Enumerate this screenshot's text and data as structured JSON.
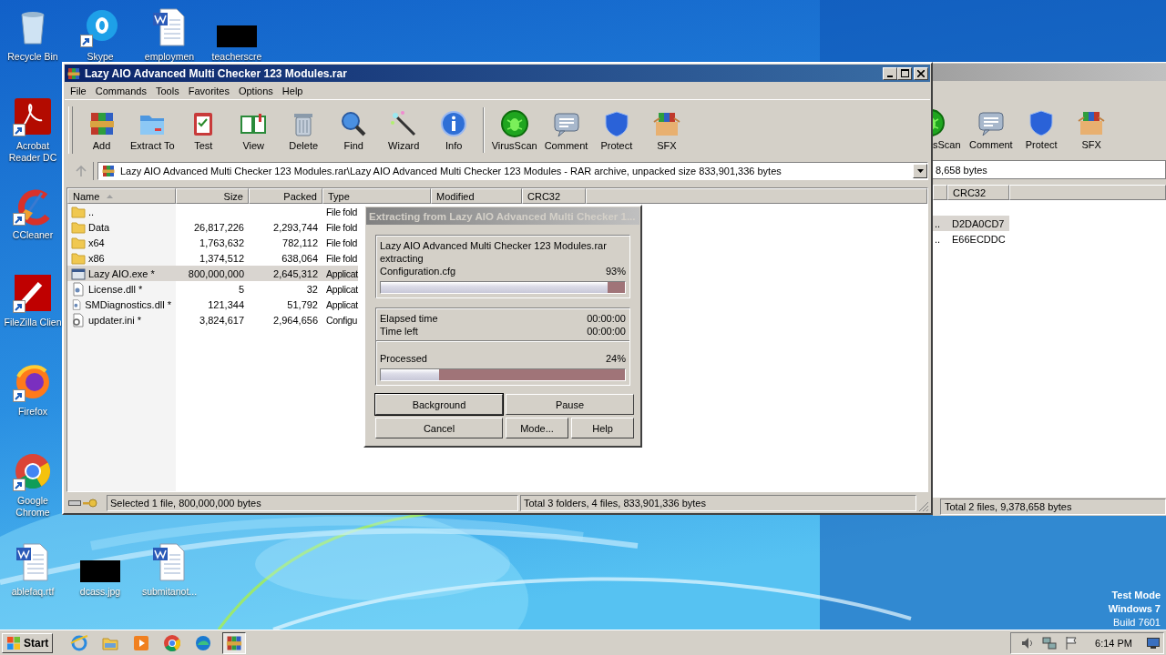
{
  "desktop_icons": [
    {
      "label": "Recycle Bin",
      "kind": "recycle",
      "shortcut": false
    },
    {
      "label": "Skype",
      "kind": "skype",
      "shortcut": true
    },
    {
      "label": "employmen",
      "kind": "word",
      "shortcut": false
    },
    {
      "label": "teacherscre",
      "kind": "redacted",
      "shortcut": false
    },
    {
      "label": "Acrobat Reader DC",
      "kind": "acrobat",
      "shortcut": true
    },
    {
      "label": "CCleaner",
      "kind": "ccleaner",
      "shortcut": true
    },
    {
      "label": "FileZilla Clien",
      "kind": "filezilla",
      "shortcut": true
    },
    {
      "label": "Firefox",
      "kind": "firefox",
      "shortcut": true
    },
    {
      "label": "Google Chrome",
      "kind": "chrome",
      "shortcut": true
    },
    {
      "label": "ablefaq.rtf",
      "kind": "word",
      "shortcut": false
    },
    {
      "label": "dcass.jpg",
      "kind": "redacted",
      "shortcut": false
    },
    {
      "label": "submitanot...",
      "kind": "word",
      "shortcut": false
    }
  ],
  "system_notice": [
    {
      "text": "Test Mode",
      "strong": true
    },
    {
      "text": "Windows 7",
      "strong": true
    },
    {
      "text": "Build 7601",
      "strong": false
    }
  ],
  "back_window": {
    "toolbar": [
      {
        "label": "sScan",
        "kind": "virus"
      },
      {
        "label": "Comment",
        "kind": "comment"
      },
      {
        "label": "Protect",
        "kind": "protect"
      },
      {
        "label": "SFX",
        "kind": "sfx"
      }
    ],
    "address": "8,658 bytes",
    "columns": [
      "CRC32"
    ],
    "rows": [
      {
        "column_1": "..",
        "crc32": "D2DA0CD7",
        "selected": true
      },
      {
        "column_1": "..",
        "crc32": "E66ECDDC",
        "selected": false
      }
    ],
    "status": "Total 2 files, 9,378,658 bytes"
  },
  "main_window": {
    "title": "Lazy AIO Advanced Multi Checker 123 Modules.rar",
    "menu": [
      "File",
      "Commands",
      "Tools",
      "Favorites",
      "Options",
      "Help"
    ],
    "toolbar_groups": [
      [
        {
          "label": "Add",
          "kind": "add"
        },
        {
          "label": "Extract To",
          "kind": "extract"
        },
        {
          "label": "Test",
          "kind": "test"
        },
        {
          "label": "View",
          "kind": "view"
        },
        {
          "label": "Delete",
          "kind": "delete"
        },
        {
          "label": "Find",
          "kind": "find"
        },
        {
          "label": "Wizard",
          "kind": "wizard"
        },
        {
          "label": "Info",
          "kind": "info"
        }
      ],
      [
        {
          "label": "VirusScan",
          "kind": "virus"
        },
        {
          "label": "Comment",
          "kind": "comment"
        },
        {
          "label": "Protect",
          "kind": "protect"
        },
        {
          "label": "SFX",
          "kind": "sfx"
        }
      ]
    ],
    "address": "Lazy AIO Advanced Multi Checker 123 Modules.rar\\Lazy AIO Advanced Multi Checker 123 Modules - RAR archive, unpacked size 833,901,336 bytes",
    "columns": [
      "Name",
      "Size",
      "Packed",
      "Type",
      "Modified",
      "CRC32"
    ],
    "rows": [
      {
        "name": "..",
        "type": "File fold",
        "kind": "parent",
        "selected": false
      },
      {
        "name": "Data",
        "size": "26,817,226",
        "packed": "2,293,744",
        "type": "File fold",
        "kind": "folder",
        "selected": false
      },
      {
        "name": "x64",
        "size": "1,763,632",
        "packed": "782,112",
        "type": "File fold",
        "kind": "folder",
        "selected": false
      },
      {
        "name": "x86",
        "size": "1,374,512",
        "packed": "638,064",
        "type": "File fold",
        "kind": "folder",
        "selected": false
      },
      {
        "name": "Lazy AIO.exe *",
        "size": "800,000,000",
        "packed": "2,645,312",
        "type": "Applicat",
        "kind": "exe",
        "selected": true
      },
      {
        "name": "License.dll *",
        "size": "5",
        "packed": "32",
        "type": "Applicat",
        "kind": "dll",
        "selected": false
      },
      {
        "name": "SMDiagnostics.dll *",
        "size": "121,344",
        "packed": "51,792",
        "type": "Applicat",
        "kind": "dll",
        "selected": false
      },
      {
        "name": "updater.ini *",
        "size": "3,824,617",
        "packed": "2,964,656",
        "type": "Configu",
        "kind": "ini",
        "selected": false
      }
    ],
    "status": [
      "Selected 1 file, 800,000,000 bytes",
      "Total 3 folders, 4 files, 833,901,336 bytes"
    ]
  },
  "dialog": {
    "title": "Extracting from Lazy AIO Advanced Multi Checker 1...",
    "archive": "Lazy AIO Advanced Multi Checker 123 Modules.rar",
    "action": "extracting",
    "file": "Configuration.cfg",
    "file_percent": "93%",
    "file_bar": {
      "level": 0.93
    },
    "elapsed_label": "Elapsed time",
    "elapsed": "00:00:00",
    "left_label": "Time left",
    "left": "00:00:00",
    "processed_label": "Processed",
    "processed_percent": "24%",
    "processed_bar": {
      "level": 0.24
    },
    "buttons": [
      {
        "label": "Background",
        "focused": true
      },
      {
        "label": "Pause",
        "focused": false
      },
      {
        "label": "Cancel",
        "focused": false
      },
      {
        "label": "Mode...",
        "focused": false
      },
      {
        "label": "Help",
        "focused": false
      }
    ]
  },
  "taskbar": {
    "start": "Start",
    "apps": [
      {
        "kind": "ie",
        "active": false
      },
      {
        "kind": "explorer",
        "active": false
      },
      {
        "kind": "media",
        "active": false
      },
      {
        "kind": "chrome",
        "active": false
      },
      {
        "kind": "edge",
        "active": false
      },
      {
        "kind": "winrar",
        "active": true
      }
    ],
    "clock": "6:14 PM"
  }
}
